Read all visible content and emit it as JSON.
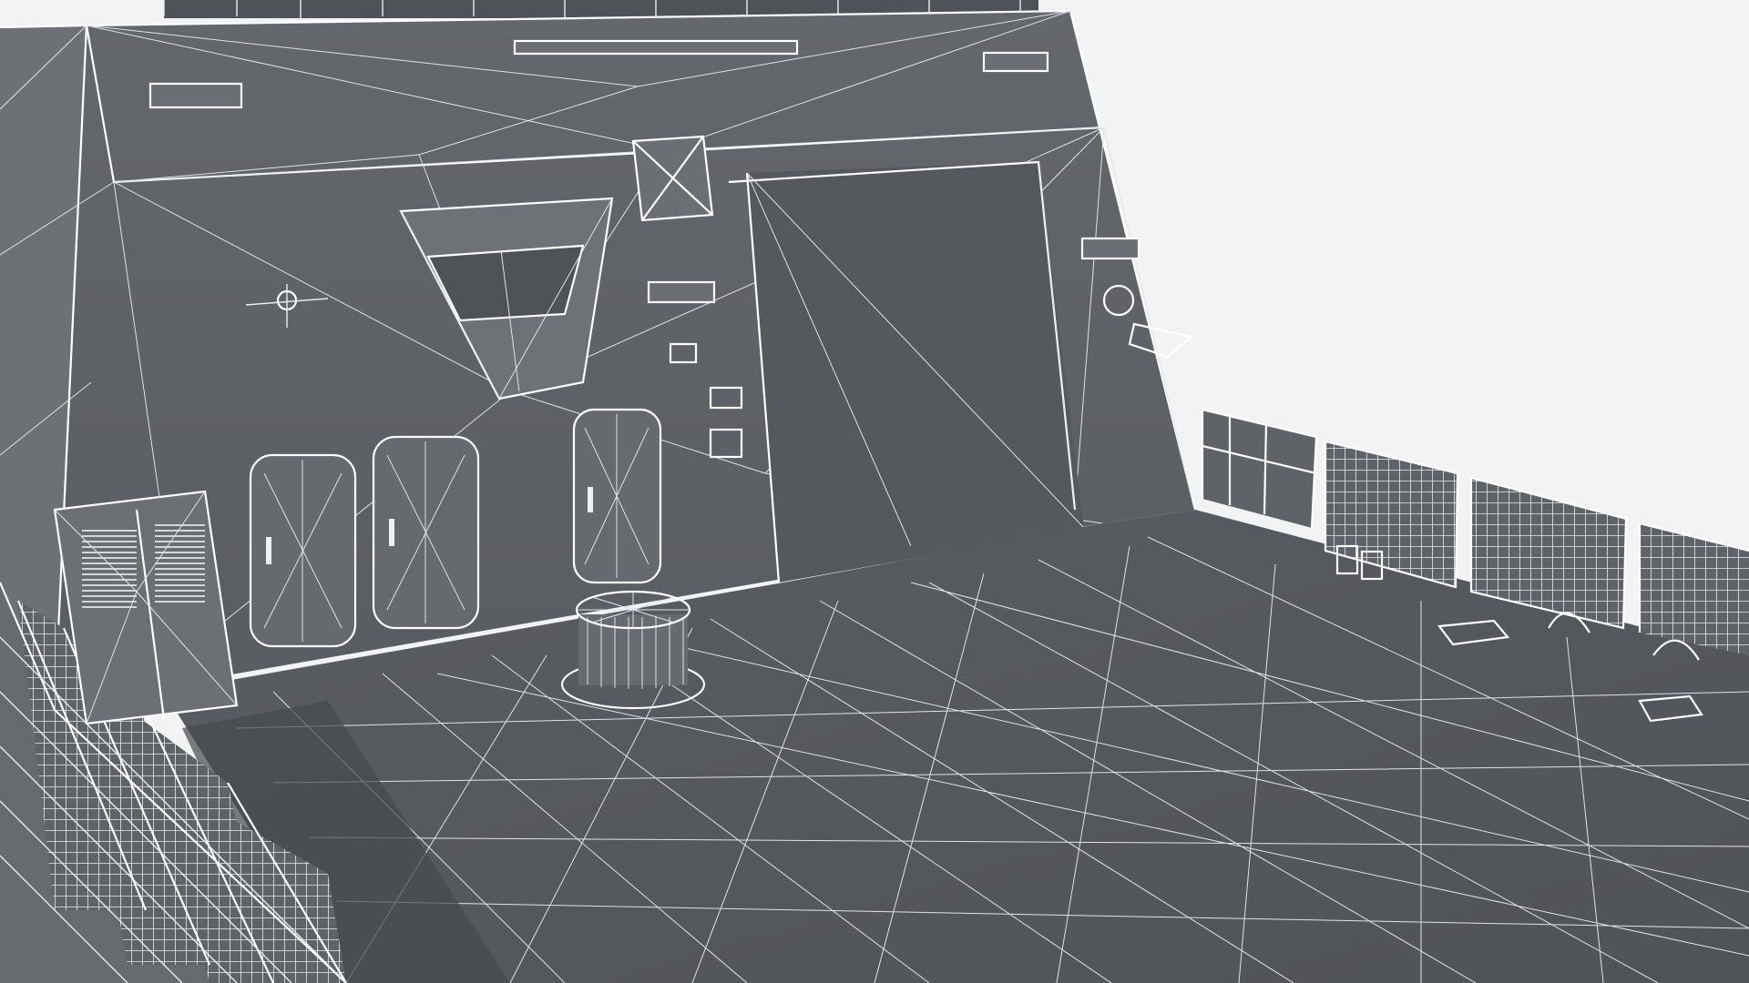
{
  "scene": {
    "subject": "3d-wireframe-ship-deck",
    "colors": {
      "background": "#f2f3f4",
      "hull": "#5d6064",
      "hull_dark": "#4a4d51",
      "deck": "#55585c",
      "wire": "#e9edf1",
      "shadow": "#3e4145"
    }
  }
}
